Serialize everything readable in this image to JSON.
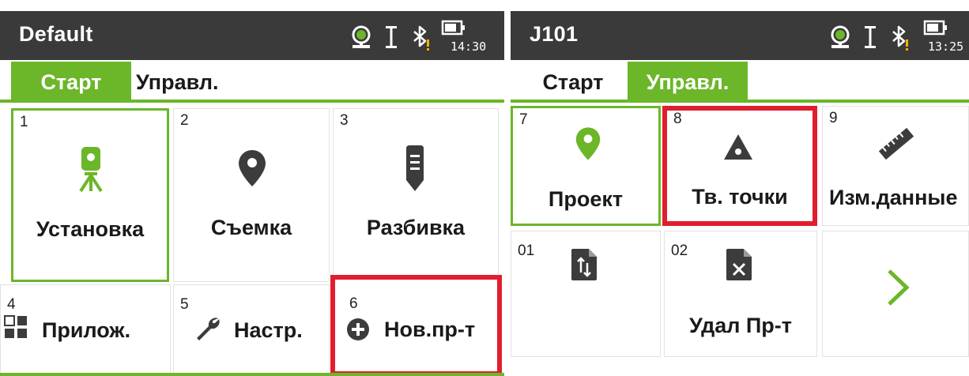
{
  "left": {
    "status": {
      "title": "Default",
      "time": "14:30",
      "icons": [
        "prism-icon",
        "text-cursor-icon",
        "bluetooth-icon",
        "battery-icon"
      ]
    },
    "tabs": [
      {
        "label": "Старт",
        "active": true
      },
      {
        "label": "Управл.",
        "active": false
      }
    ],
    "tiles": [
      {
        "num": "1",
        "label": "Установка",
        "icon": "tripod-instrument-icon"
      },
      {
        "num": "2",
        "label": "Съемка",
        "icon": "location-pin-icon"
      },
      {
        "num": "3",
        "label": "Разбивка",
        "icon": "stakeout-marker-icon"
      },
      {
        "num": "4",
        "label": "Прилож.",
        "icon": "apps-grid-icon"
      },
      {
        "num": "5",
        "label": "Настр.",
        "icon": "wrench-icon"
      },
      {
        "num": "6",
        "label": "Нов.пр-т",
        "icon": "plus-circle-icon"
      }
    ]
  },
  "right": {
    "status": {
      "title": "J101",
      "time": "13:25",
      "icons": [
        "prism-icon",
        "text-cursor-icon",
        "bluetooth-icon",
        "battery-icon"
      ]
    },
    "tabs": [
      {
        "label": "Старт",
        "active": false
      },
      {
        "label": "Управл.",
        "active": true
      }
    ],
    "tiles": [
      {
        "num": "7",
        "label": "Проект",
        "icon": "location-pin-icon"
      },
      {
        "num": "8",
        "label": "Тв. точки",
        "icon": "triangle-point-icon"
      },
      {
        "num": "9",
        "label": "Изм.данные",
        "icon": "ruler-icon"
      },
      {
        "num": "01",
        "label": "",
        "icon": "file-transfer-icon"
      },
      {
        "num": "02",
        "label": "Удал Пр-т",
        "icon": "file-delete-icon"
      },
      {
        "num": "",
        "label": "",
        "icon": "chevron-right-icon"
      }
    ]
  },
  "colors": {
    "accent": "#6cb629",
    "statusbar": "#3a3a3a",
    "highlight": "#e01e2e",
    "icon": "#3c3c3c"
  }
}
